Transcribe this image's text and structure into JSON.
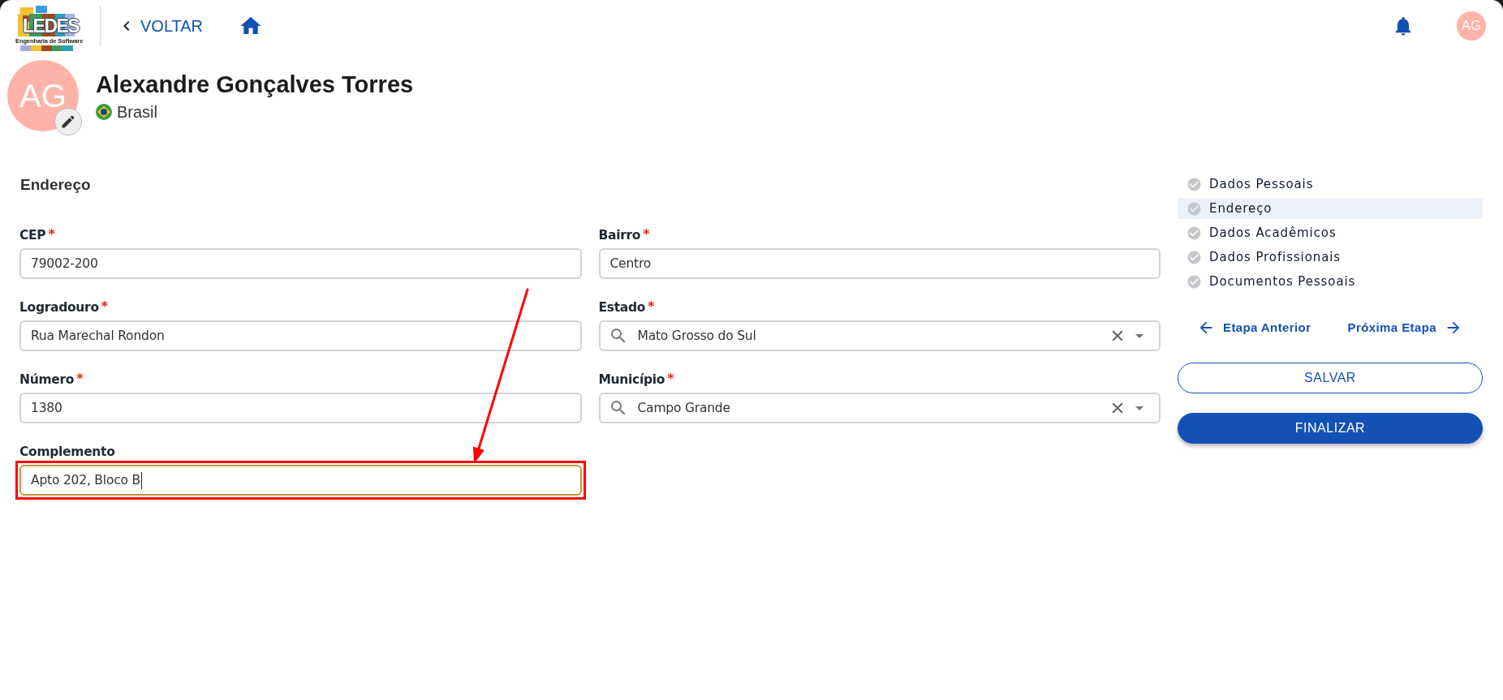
{
  "header": {
    "logo": {
      "title": "LEDES",
      "subtitle": "Engenharia de Software"
    },
    "back_label": "VOLTAR",
    "user_initials": "AG"
  },
  "profile": {
    "initials": "AG",
    "name": "Alexandre Gonçalves Torres",
    "country": "Brasil"
  },
  "form": {
    "title": "Endereço",
    "required_mark": "*",
    "fields": [
      {
        "label": "CEP",
        "required": true,
        "kind": "text",
        "value": "79002-200",
        "focused": false,
        "highlighted": false
      },
      {
        "label": "Bairro",
        "required": true,
        "kind": "text",
        "value": "Centro",
        "focused": false,
        "highlighted": false
      },
      {
        "label": "Logradouro",
        "required": true,
        "kind": "text",
        "value": "Rua Marechal Rondon",
        "focused": false,
        "highlighted": false
      },
      {
        "label": "Estado",
        "required": true,
        "kind": "search",
        "value": "Mato Grosso do Sul",
        "focused": false,
        "highlighted": false
      },
      {
        "label": "Número",
        "required": true,
        "kind": "text",
        "value": "1380",
        "focused": false,
        "highlighted": false
      },
      {
        "label": "Município",
        "required": true,
        "kind": "search",
        "value": "Campo Grande",
        "focused": false,
        "highlighted": false
      },
      {
        "label": "Complemento",
        "required": false,
        "kind": "text",
        "value": "Apto 202, Bloco B",
        "focused": true,
        "highlighted": true
      }
    ]
  },
  "steps": [
    {
      "label": "Dados Pessoais",
      "selected": false
    },
    {
      "label": "Endereço",
      "selected": true
    },
    {
      "label": "Dados Acadêmicos",
      "selected": false
    },
    {
      "label": "Dados Profissionais",
      "selected": false
    },
    {
      "label": "Documentos Pessoais",
      "selected": false
    }
  ],
  "step_nav": {
    "previous": "Etapa Anterior",
    "next": "Próxima Etapa"
  },
  "actions": [
    {
      "label": "SALVAR",
      "kind": "outline"
    },
    {
      "label": "FINALIZAR",
      "kind": "primary"
    }
  ]
}
